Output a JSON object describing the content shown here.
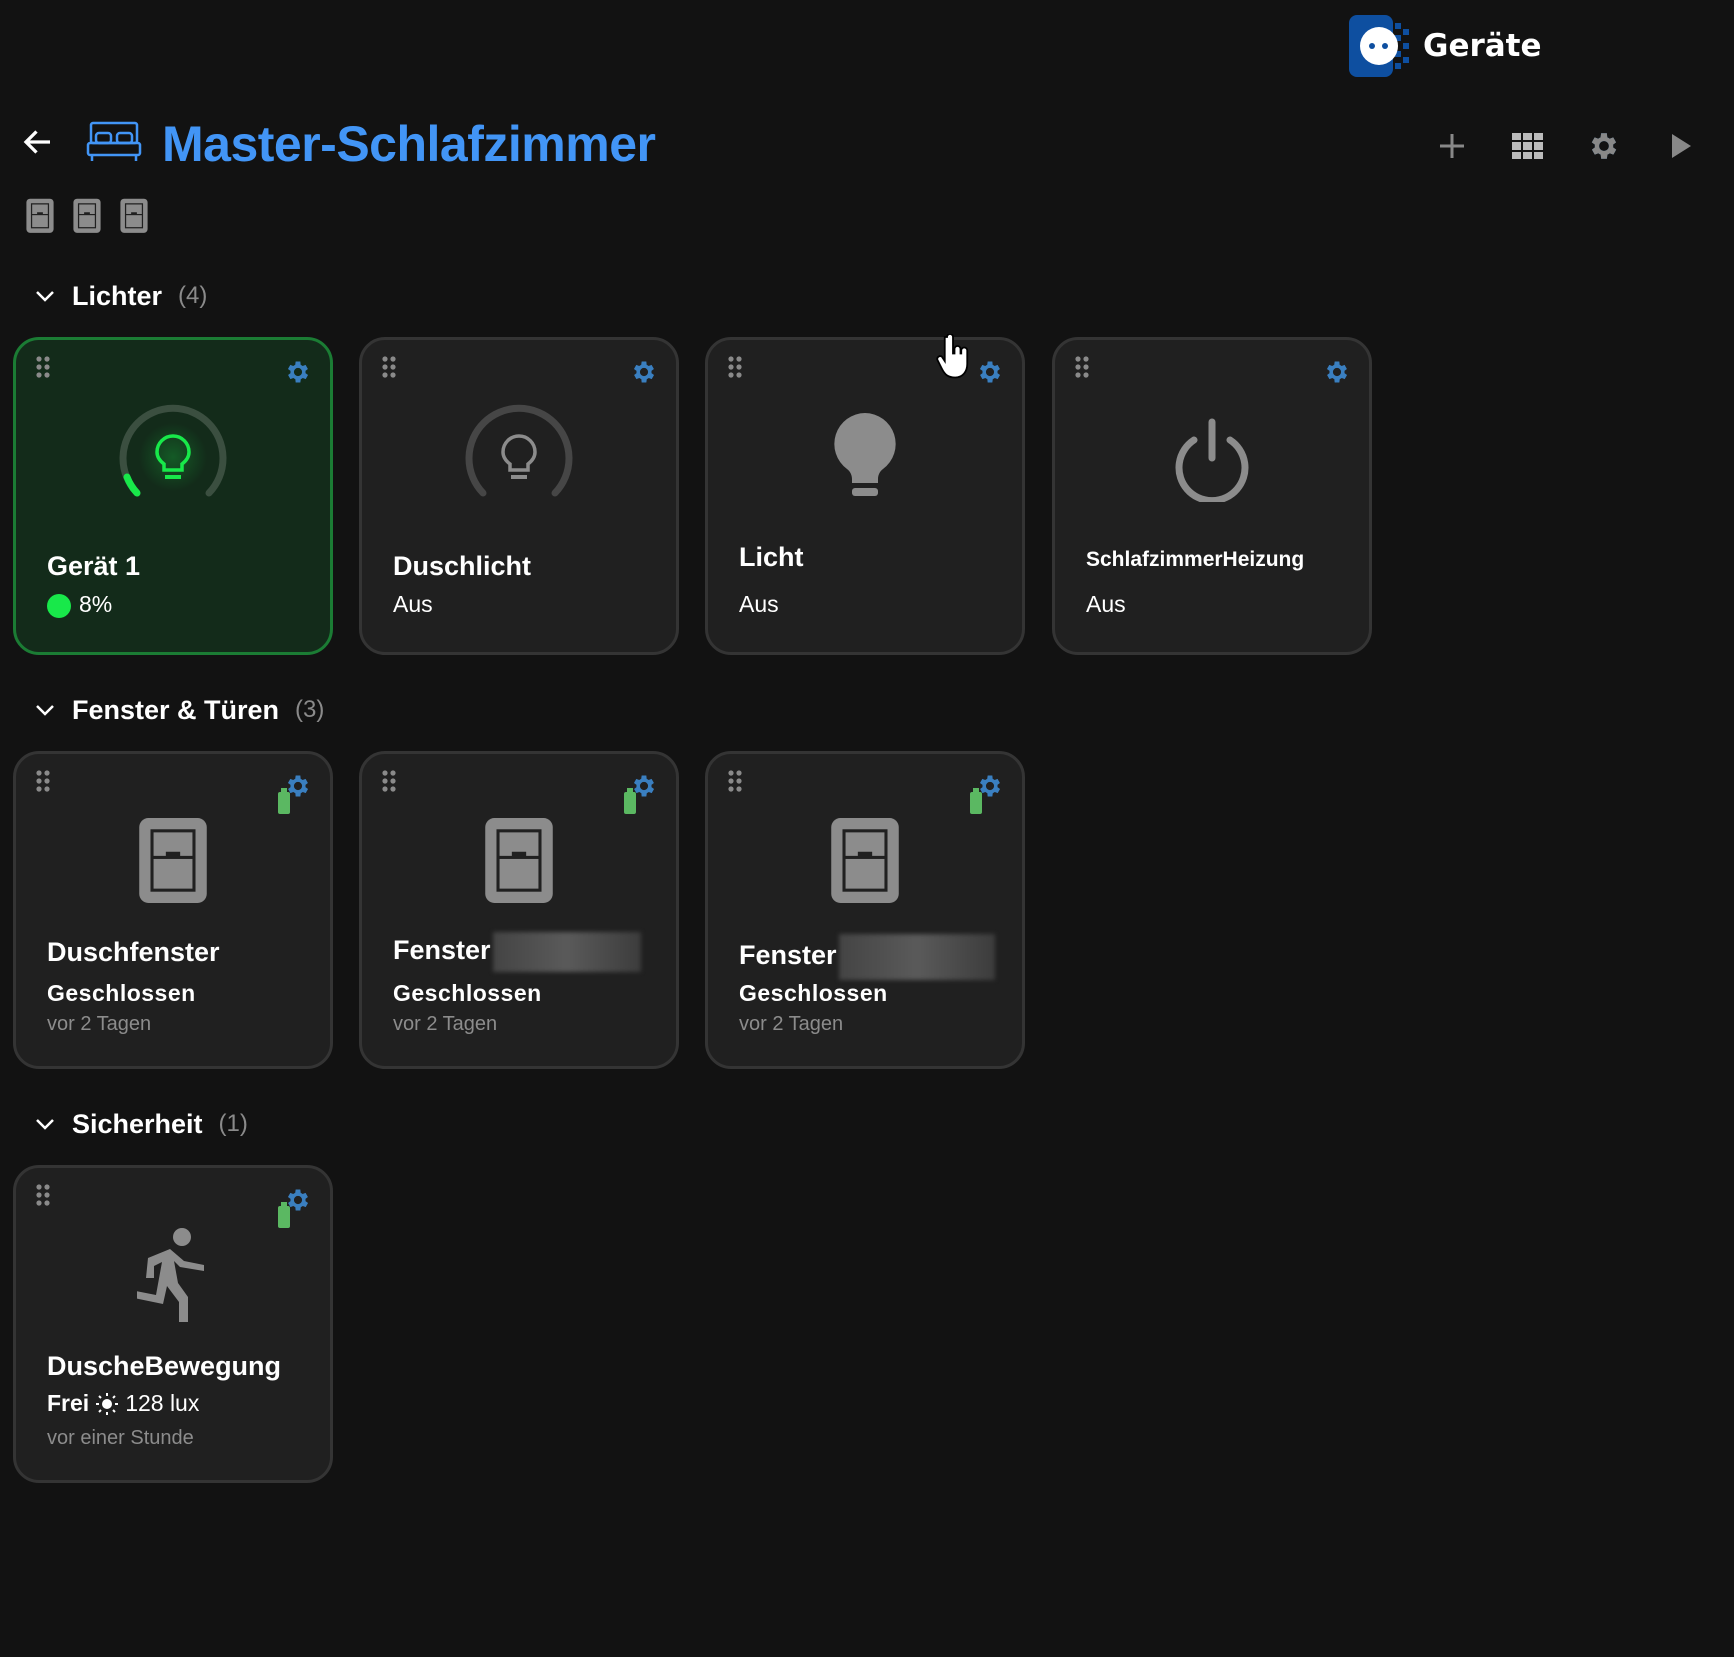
{
  "header": {
    "brand": "Geräte",
    "title": "Master-Schlafzimmer"
  },
  "colors": {
    "accent": "#4295f6",
    "on": "#18e84a",
    "gear": "#3a7fc0",
    "battery": "#5bb862"
  },
  "sections": [
    {
      "name": "Lichter",
      "count": "(4)",
      "cards": [
        {
          "name": "Gerät 1",
          "status": "8%",
          "brightness_percent": 8,
          "icon": "lightbulb-gauge-icon"
        },
        {
          "name": "Duschlicht",
          "status": "Aus",
          "icon": "lightbulb-gauge-icon"
        },
        {
          "name": "Licht",
          "status": "Aus",
          "icon": "lightbulb-icon"
        },
        {
          "name": "SchlafzimmerHeizung",
          "status": "Aus",
          "icon": "power-icon"
        }
      ]
    },
    {
      "name": "Fenster & Türen",
      "count": "(3)",
      "cards": [
        {
          "name": "Duschfenster",
          "status": "Geschlossen",
          "time": "vor 2 Tagen"
        },
        {
          "name": "Fenster",
          "status": "Geschlossen",
          "time": "vor 2 Tagen"
        },
        {
          "name": "Fenster",
          "status": "Geschlossen",
          "time": "vor 2 Tagen"
        }
      ]
    },
    {
      "name": "Sicherheit",
      "count": "(1)",
      "cards": [
        {
          "name": "DuscheBewegung",
          "status": "Frei",
          "lux": "128 lux",
          "time": "vor einer Stunde"
        }
      ]
    }
  ]
}
